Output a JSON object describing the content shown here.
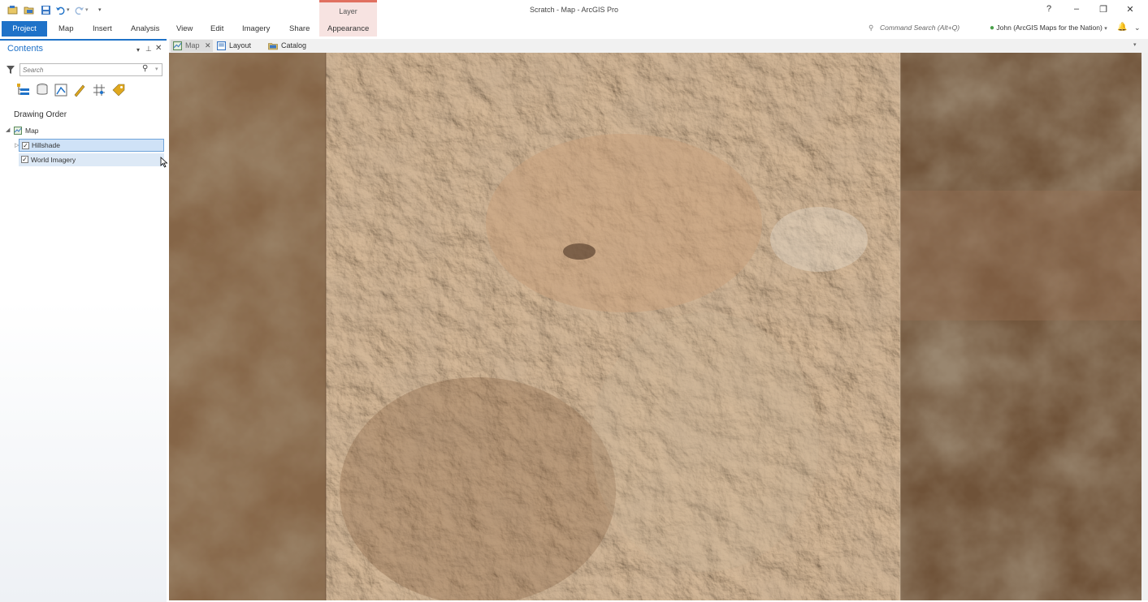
{
  "window": {
    "title": "Scratch - Map - ArcGIS Pro",
    "help": "?",
    "minimize": "–",
    "restore": "❐",
    "close": "✕"
  },
  "contextual_tab": {
    "group_label": "Layer",
    "tab_label": "Appearance"
  },
  "ribbon": {
    "tabs": [
      "Project",
      "Map",
      "Insert",
      "Analysis",
      "View",
      "Edit",
      "Imagery",
      "Share"
    ],
    "command_search_placeholder": "Command Search (Alt+Q)",
    "user": "John (ArcGIS Maps for the Nation)"
  },
  "contents": {
    "title": "Contents",
    "search_placeholder": "Search",
    "drawing_order_label": "Drawing Order",
    "map_label": "Map",
    "layers": [
      {
        "name": "Hillshade",
        "checked": true,
        "selected": true
      },
      {
        "name": "World Imagery",
        "checked": true,
        "selected": false
      }
    ],
    "tool_icons": [
      "list-by-drawing-order-icon",
      "list-by-source-icon",
      "list-by-selection-icon",
      "list-by-editing-icon",
      "list-by-snapping-icon",
      "list-by-labeling-icon"
    ]
  },
  "view_tabs": [
    {
      "label": "Map",
      "active": true,
      "icon": "map-icon"
    },
    {
      "label": "Layout",
      "active": false,
      "icon": "layout-icon"
    },
    {
      "label": "Catalog",
      "active": false,
      "icon": "catalog-icon"
    }
  ],
  "colors": {
    "accent": "#1f72c8",
    "contextual": "#e07060",
    "terrain_light": "#c9a885",
    "terrain_dark": "#6d5037"
  }
}
